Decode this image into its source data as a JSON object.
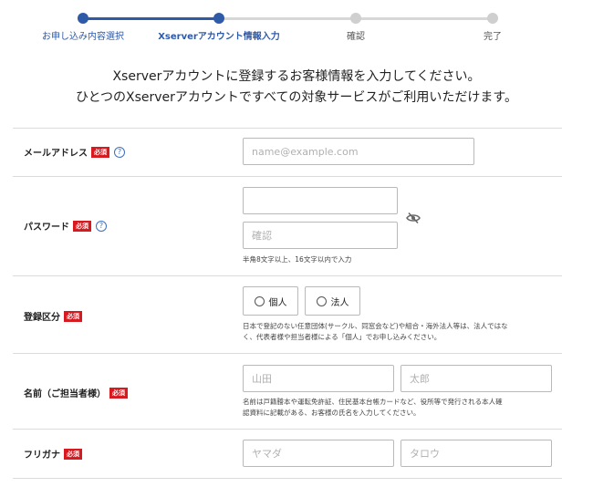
{
  "stepper": {
    "steps": [
      {
        "label": "お申し込み内容選択",
        "state": "done"
      },
      {
        "label": "Xserverアカウント情報入力",
        "state": "current"
      },
      {
        "label": "確認",
        "state": "todo"
      },
      {
        "label": "完了",
        "state": "todo"
      }
    ]
  },
  "intro": {
    "line1": "Xserverアカウントに登録するお客様情報を入力してください。",
    "line2": "ひとつのXserverアカウントですべての対象サービスがご利用いただけます。"
  },
  "required_badge": "必須",
  "help_glyph": "?",
  "email": {
    "label": "メールアドレス",
    "placeholder": "name@example.com",
    "value": ""
  },
  "password": {
    "label": "パスワード",
    "value": "",
    "confirm_placeholder": "確認",
    "note": "半角8文字以上、16文字以内で入力",
    "toggle_icon": "eye-slash-icon"
  },
  "registration_type": {
    "label": "登録区分",
    "options": [
      {
        "label": "個人",
        "selected": false
      },
      {
        "label": "法人",
        "selected": false
      }
    ],
    "note_line1": "日本で登記のない任意団体(サークル、同窓会など)や組合・海外法人等は、法人ではな",
    "note_line2": "く、代表者様や担当者様による「個人」でお申し込みください。"
  },
  "name": {
    "label": "名前（ご担当者様）",
    "last_placeholder": "山田",
    "first_placeholder": "太郎",
    "note_line1": "名前は戸籍謄本や運転免許証、住民基本台帳カードなど、役所等で発行される本人確",
    "note_line2": "認資料に記載がある、お客様の氏名を入力してください。"
  },
  "furigana": {
    "label": "フリガナ",
    "last_placeholder": "ヤマダ",
    "first_placeholder": "タロウ"
  },
  "colors": {
    "accent": "#2f5aa8",
    "inactive": "#cfcfcf",
    "required": "#d71920",
    "border": "#b9b9b9"
  }
}
